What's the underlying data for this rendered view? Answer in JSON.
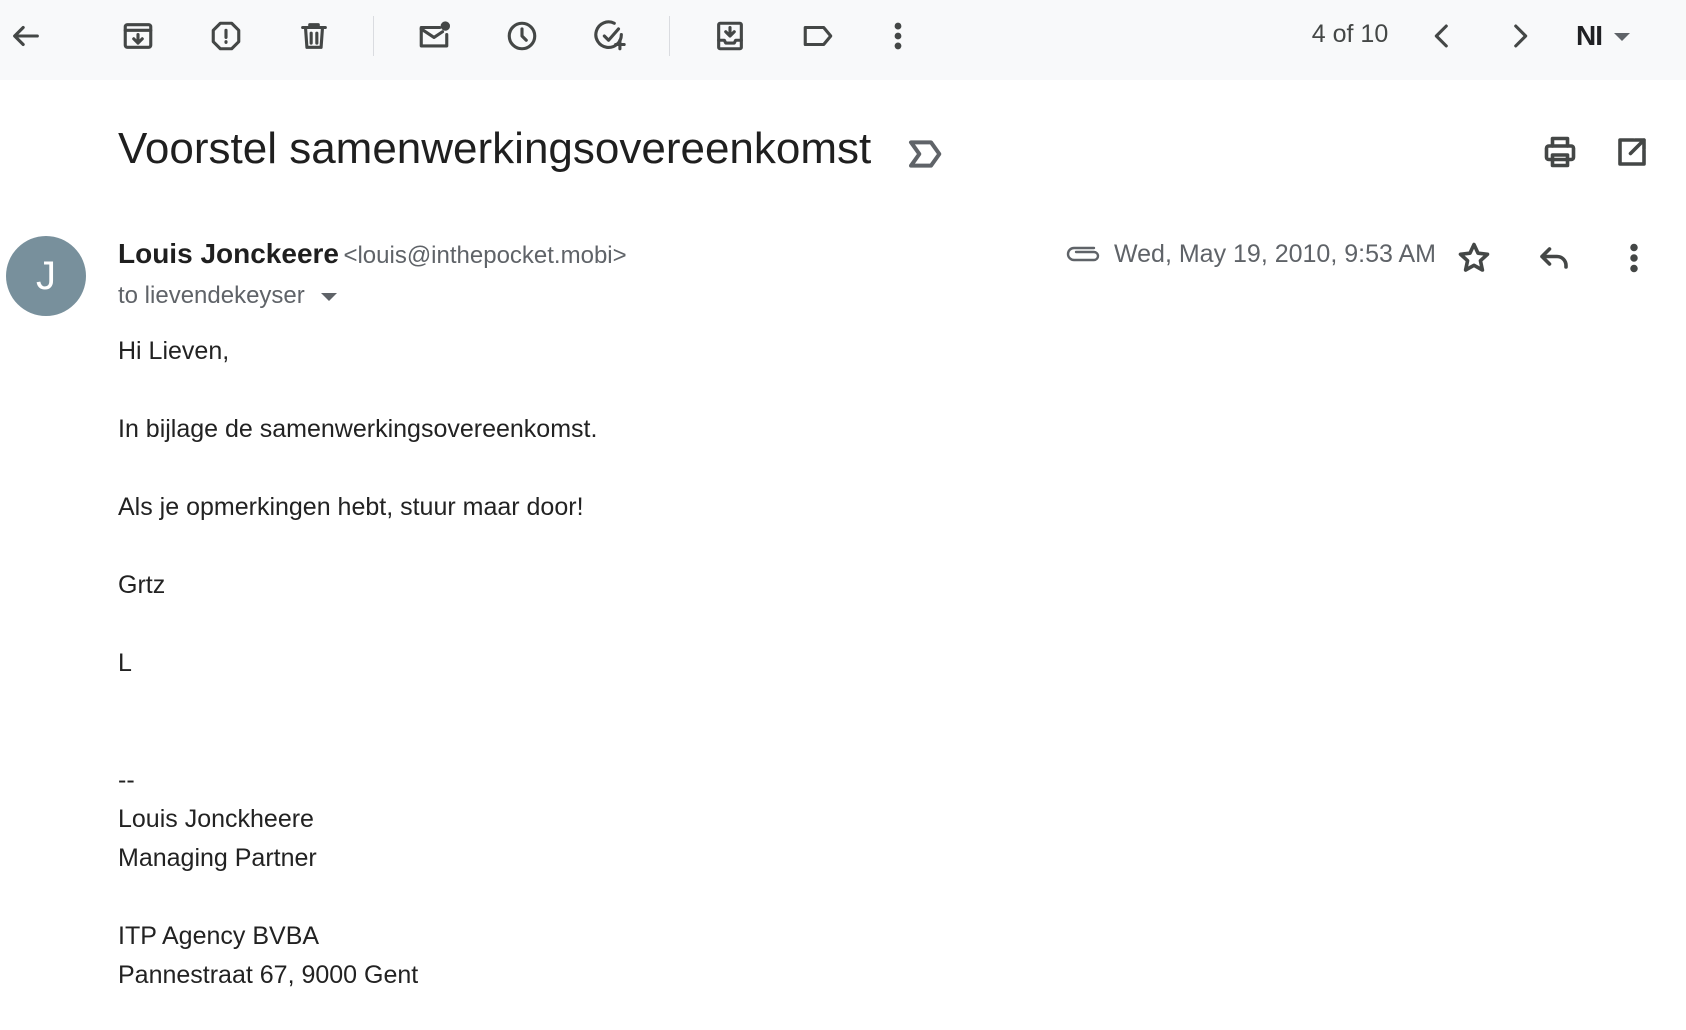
{
  "toolbar": {
    "icons": [
      "back-arrow-icon",
      "archive-icon",
      "report-spam-icon",
      "delete-icon",
      "mark-unread-icon",
      "snooze-icon",
      "add-task-icon",
      "move-to-icon",
      "label-icon",
      "more-vert-icon"
    ],
    "pager": "4 of 10",
    "input_tool_label": "NI"
  },
  "email": {
    "subject": "Voorstel samenwerkingsovereenkomst",
    "avatar_letter": "J",
    "avatar_color": "#78909c",
    "sender_name": "Louis Jonckeere",
    "sender_email": "<louis@inthepocket.mobi>",
    "recipient": "to lievendekeyser",
    "date": "Wed, May 19, 2010, 9:53 AM",
    "body": {
      "greeting": "Hi Lieven,",
      "line1": "In bijlage de samenwerkingsovereenkomst.",
      "line2": "Als je opmerkingen hebt, stuur maar door!",
      "closing": "Grtz",
      "initial": "L",
      "sig_sep": "--",
      "sig_name": "Louis Jonckheere",
      "sig_title": "Managing Partner",
      "sig_company": "ITP Agency BVBA",
      "sig_address": "Pannestraat 67, 9000 Gent"
    }
  }
}
